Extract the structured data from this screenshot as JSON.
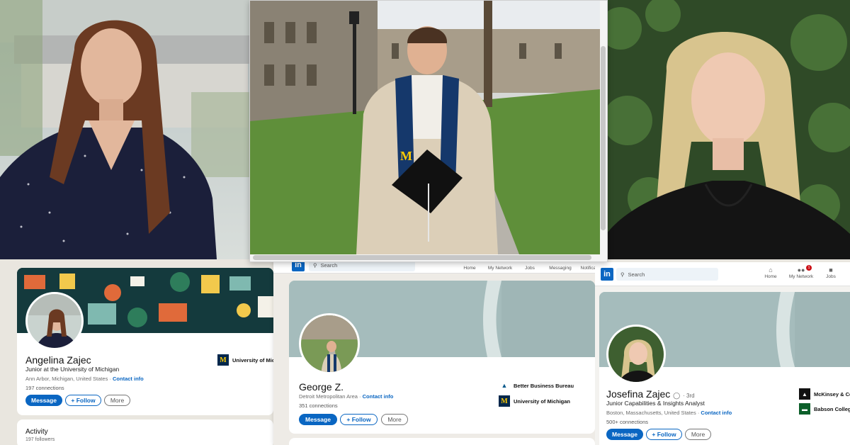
{
  "left_profile": {
    "name": "Angelina Zajec",
    "headline": "Junior at the University of Michigan",
    "location": "Ann Arbor, Michigan, United States",
    "contact_info": "Contact info",
    "connections": "197 connections",
    "org": "University of Mic",
    "buttons": {
      "message": "Message",
      "follow": "+ Follow",
      "more": "More"
    },
    "activity_title": "Activity",
    "followers": "197 followers"
  },
  "mid_profile": {
    "nav": {
      "search": "Search",
      "items": [
        "Home",
        "My Network",
        "Jobs",
        "Messaging",
        "Notificati"
      ]
    },
    "name": "George Z.",
    "location": "Detroit Metropolitan Area",
    "contact_info": "Contact info",
    "connections": "351 connections",
    "orgs": [
      "Better Business Bureau",
      "University of Michigan"
    ],
    "buttons": {
      "message": "Message",
      "follow": "+ Follow",
      "more": "More"
    }
  },
  "right_profile": {
    "nav": {
      "search": "Search",
      "items": [
        "Home",
        "My Network",
        "Jobs"
      ],
      "network_badge": "1"
    },
    "name": "Josefina Zajec",
    "degree": "· 3rd",
    "headline": "Junior Capabilities & Insights Analyst",
    "location": "Boston, Massachusetts, United States",
    "contact_info": "Contact info",
    "connections": "500+ connections",
    "orgs": [
      "McKinsey & Co",
      "Babson Colleg"
    ],
    "buttons": {
      "message": "Message",
      "follow": "+ Follow",
      "more": "More"
    }
  },
  "colors": {
    "linkedin_blue": "#0a66c2",
    "banner_teal": "#a5bcbc",
    "umich_blue": "#00274c",
    "umich_maize": "#ffcb05"
  }
}
